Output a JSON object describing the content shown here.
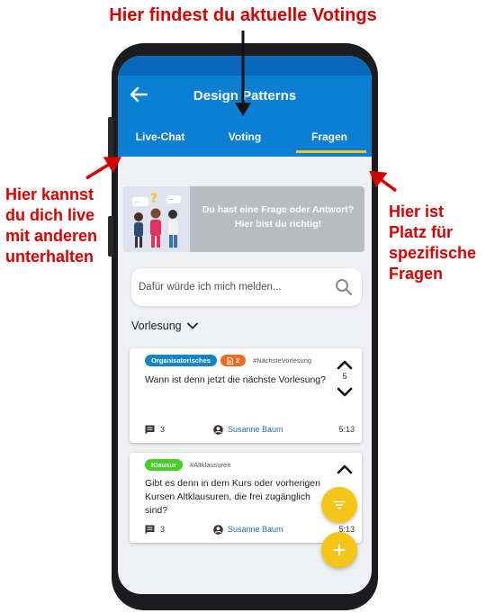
{
  "annotations": {
    "top": "Hier findest du aktuelle Votings",
    "left": [
      "Hier kannst",
      "du dich live",
      "mit anderen",
      "unterhalten"
    ],
    "right": [
      "Hier ist",
      "Platz für",
      "spezifische",
      "Fragen"
    ]
  },
  "header": {
    "title": "Design Patterns",
    "tabs": [
      "Live-Chat",
      "Voting",
      "Fragen"
    ],
    "active_tab": "Fragen"
  },
  "banner": {
    "text": "Du hast eine Frage oder Antwort? Hier bist du richtig!"
  },
  "search": {
    "placeholder": "Dafür würde ich mich melden..."
  },
  "filter": {
    "selected": "Vorlesung"
  },
  "questions": [
    {
      "tags": [
        "Organisatorisches"
      ],
      "badge_count": "2",
      "hashtag": "#NächsteVorlesung",
      "text": "Wann ist denn jetzt die nächste Vorlesung?",
      "votes": "5",
      "comments": "3",
      "author": "Susanne Baum",
      "time": "5:13"
    },
    {
      "tags": [
        "Klausur"
      ],
      "hashtag": "#Altklausuren",
      "text": "Gibt es denn in dem Kurs oder vorherigen Kursen Altklausuren, die frei zugänglich sind?",
      "comments": "3",
      "author": "Susanne Baum",
      "time": "5:13"
    }
  ],
  "colors": {
    "header": "#0a7fd4",
    "accent": "#f5c518",
    "annotation": "#d40000",
    "tag_organisatorisches": "#1385c6",
    "tag_badge": "#f06a22",
    "tag_klausur": "#44cf25"
  },
  "icons": [
    "back-arrow-icon",
    "search-icon",
    "chevron-down-icon",
    "chevron-up-icon",
    "comment-icon",
    "user-icon",
    "document-icon",
    "filter-icon",
    "plus-icon"
  ]
}
